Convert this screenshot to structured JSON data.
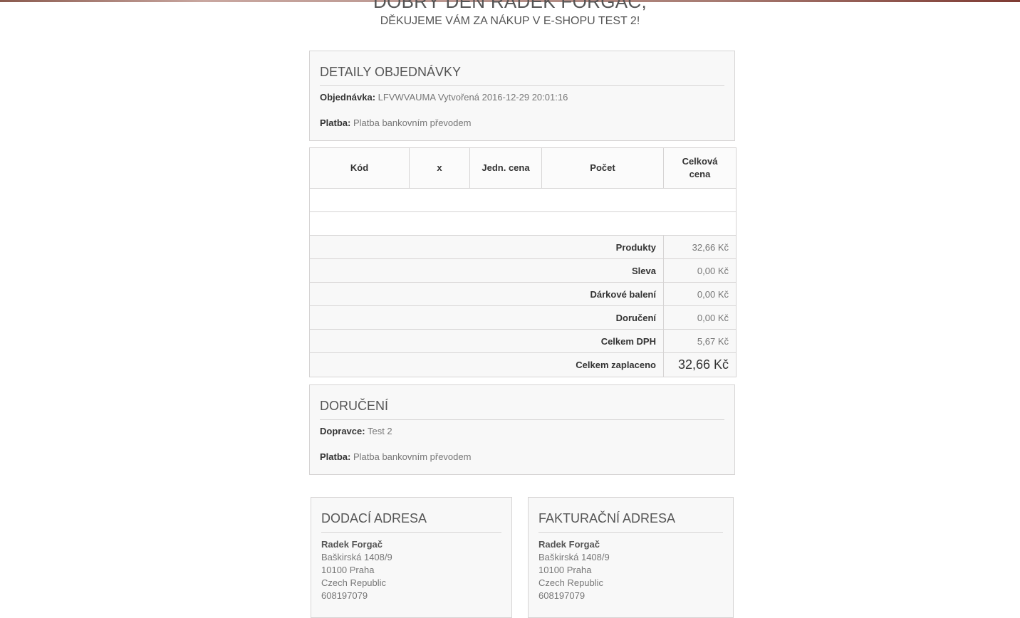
{
  "header": {
    "greeting": "DOBRÝ DEN RADEK FORGÁČ,",
    "thanks": "DĚKUJEME VÁM ZA NÁKUP V E-SHOPU TEST 2!"
  },
  "order_details": {
    "title": "DETAILY OBJEDNÁVKY",
    "order_label": "Objednávka:",
    "order_value": "LFVWVAUMA Vytvořená 2016-12-29 20:01:16",
    "payment_label": "Platba:",
    "payment_value": "Platba bankovním převodem"
  },
  "table": {
    "headers": [
      "Kód",
      "x",
      "Jedn. cena",
      "Počet",
      "Celková cena"
    ],
    "summary": [
      {
        "label": "Produkty",
        "value": "32,66 Kč"
      },
      {
        "label": "Sleva",
        "value": "0,00 Kč"
      },
      {
        "label": "Dárkové balení",
        "value": "0,00 Kč"
      },
      {
        "label": "Doručení",
        "value": "0,00 Kč"
      },
      {
        "label": "Celkem DPH",
        "value": "5,67 Kč"
      },
      {
        "label": "Celkem zaplaceno",
        "value": "32,66 Kč"
      }
    ]
  },
  "delivery": {
    "title": "DORUČENÍ",
    "carrier_label": "Dopravce:",
    "carrier_value": "Test 2",
    "payment_label": "Platba:",
    "payment_value": "Platba bankovním převodem"
  },
  "shipping_address": {
    "title": "DODACÍ ADRESA",
    "name": "Radek Forgač",
    "street": "Baškirská 1408/9",
    "city": "10100 Praha",
    "country": "Czech Republic",
    "phone": "608197079"
  },
  "billing_address": {
    "title": "FAKTURAČNÍ ADRESA",
    "name": "Radek Forgač",
    "street": "Baškirská 1408/9",
    "city": "10100 Praha",
    "country": "Czech Republic",
    "phone": "608197079"
  }
}
